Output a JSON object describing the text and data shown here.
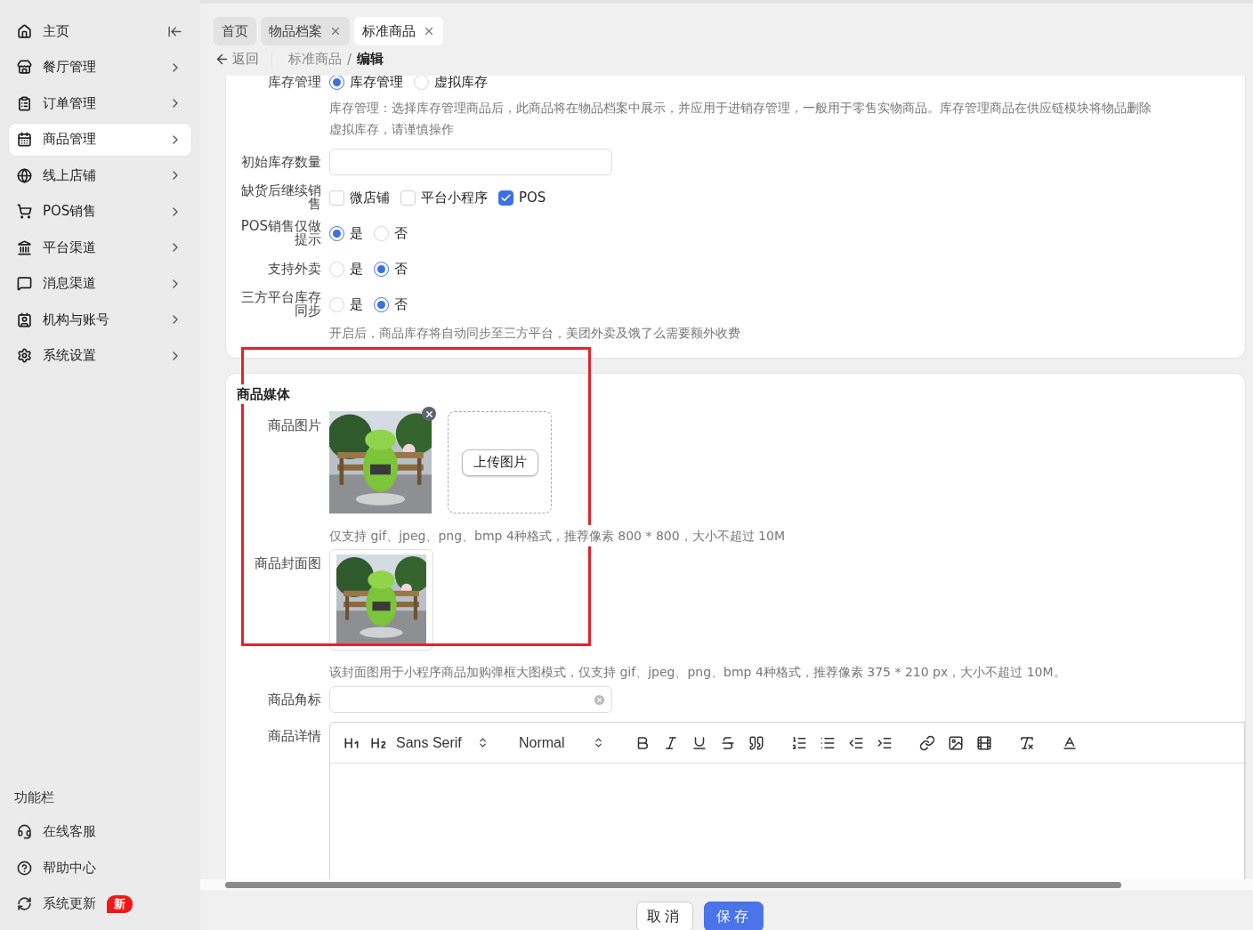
{
  "sidebar": {
    "items": [
      {
        "label": "主页",
        "selected": false,
        "has_submenu": false
      },
      {
        "label": "餐厅管理",
        "selected": false,
        "has_submenu": true
      },
      {
        "label": "订单管理",
        "selected": false,
        "has_submenu": true
      },
      {
        "label": "商品管理",
        "selected": true,
        "has_submenu": true
      },
      {
        "label": "线上店铺",
        "selected": false,
        "has_submenu": true
      },
      {
        "label": "POS销售",
        "selected": false,
        "has_submenu": true
      },
      {
        "label": "平台渠道",
        "selected": false,
        "has_submenu": true
      },
      {
        "label": "消息渠道",
        "selected": false,
        "has_submenu": true
      },
      {
        "label": "机构与账号",
        "selected": false,
        "has_submenu": true
      },
      {
        "label": "系统设置",
        "selected": false,
        "has_submenu": true
      }
    ],
    "section_title": "功能栏",
    "tools": [
      {
        "label": "在线客服"
      },
      {
        "label": "帮助中心"
      },
      {
        "label": "系统更新",
        "badge": "新"
      }
    ]
  },
  "tabs": [
    {
      "label": "首页",
      "selected": false,
      "closable": false
    },
    {
      "label": "物品档案",
      "selected": false,
      "closable": true
    },
    {
      "label": "标准商品",
      "selected": true,
      "closable": true
    }
  ],
  "breadcrumb": {
    "back": "返回",
    "separator": "/",
    "path": [
      "标准商品",
      "编辑"
    ]
  },
  "stock_form": {
    "rows": [
      {
        "kind": "radio",
        "label": "库存管理",
        "options": [
          {
            "label": "库存管理",
            "selected": true
          },
          {
            "label": "虚拟库存",
            "selected": false
          }
        ]
      },
      {
        "kind": "hint",
        "lines": [
          "库存管理：选择库存管理商品后，此商品将在物品档案中展示，并应用于进销存管理，一般用于零售实物商品。库存管理商品在供应链模块将物品删除",
          "虚拟库存，请谨慎操作"
        ]
      },
      {
        "kind": "input",
        "label": "初始库存数量"
      },
      {
        "kind": "checkbox",
        "label": "缺货后继续销售",
        "options": [
          {
            "label": "微店铺",
            "checked": false
          },
          {
            "label": "平台小程序",
            "checked": false
          },
          {
            "label": "POS",
            "checked": true
          }
        ]
      },
      {
        "kind": "radio",
        "label": "POS销售仅做提示",
        "options": [
          {
            "label": "是",
            "selected": true
          },
          {
            "label": "否",
            "selected": false
          }
        ]
      },
      {
        "kind": "radio",
        "label": "支持外卖",
        "options": [
          {
            "label": "是",
            "selected": false
          },
          {
            "label": "否",
            "selected": true
          }
        ]
      },
      {
        "kind": "radio",
        "label": "三方平台库存同步",
        "options": [
          {
            "label": "是",
            "selected": false
          },
          {
            "label": "否",
            "selected": true
          }
        ]
      },
      {
        "kind": "hint",
        "lines": [
          "开启后，商品库存将自动同步至三方平台，美团外卖及饿了么需要额外收费"
        ]
      }
    ]
  },
  "media_form": {
    "title": "商品媒体",
    "images": {
      "label": "商品图片",
      "upload_button": "上传图片"
    },
    "images_hint": "仅支持 gif、jpeg、png、bmp 4种格式，推荐像素 800 * 800，大小不超过 10M",
    "cover": {
      "label": "商品封面图"
    },
    "cover_hint": "该封面图用于小程序商品加购弹框大图模式，仅支持 gif、jpeg、png、bmp 4种格式，推荐像素 375 * 210 px，大小不超过 10M。",
    "corner_mark": {
      "label": "商品角标"
    },
    "detail": {
      "label": "商品详情",
      "font": "Sans Serif",
      "size": "Normal"
    }
  },
  "highlight": {
    "color": "#e6212a"
  },
  "footer": {
    "buttons": [
      {
        "label": "取消",
        "kind": "default"
      },
      {
        "label": "保存",
        "kind": "primary"
      }
    ]
  }
}
